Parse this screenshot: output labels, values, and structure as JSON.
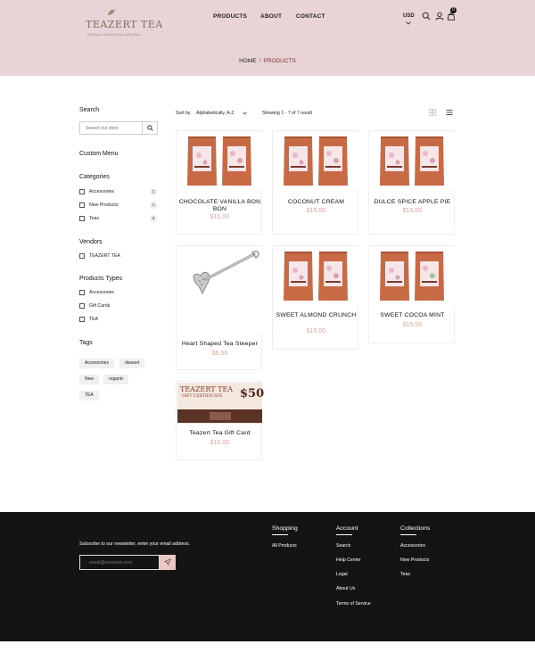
{
  "brand": {
    "name": "TEAZERT TEA",
    "tagline": "Delicious Gourmet Specialty Teas"
  },
  "nav": {
    "items": [
      "PRODUCTS",
      "ABOUT",
      "CONTACT"
    ],
    "currency": "USD",
    "cart_count": "0"
  },
  "breadcrumb": {
    "home": "HOME",
    "separator": "/",
    "current": "PRODUCTS"
  },
  "sidebar": {
    "search_heading": "Search",
    "search_placeholder": "Search our store",
    "custom_menu_heading": "Custom Menu",
    "categories_heading": "Categories",
    "categories": [
      {
        "label": "Accessories",
        "count": "1"
      },
      {
        "label": "New Products",
        "count": "1"
      },
      {
        "label": "Teas",
        "count": "3"
      }
    ],
    "vendors_heading": "Vendors",
    "vendors": [
      "TEAZERT TEA"
    ],
    "types_heading": "Products Types",
    "types": [
      "Accessories",
      "Gift Cards",
      "TEA"
    ],
    "tags_heading": "Tags",
    "tags": [
      "Accessories",
      "dessert",
      "New",
      "organic",
      "TEA"
    ]
  },
  "toolbar": {
    "sort_label": "Sort by",
    "sort_value": "Alphabetically, A-Z",
    "showing": "Showing 1 - 7 of 7 result"
  },
  "products": [
    {
      "name": "CHOCOLATE VANILLA BON BON",
      "price": "$15.00",
      "image": "tea-pouches"
    },
    {
      "name": "COCONUT CREAM",
      "price": "$15.00",
      "image": "tea-pouches"
    },
    {
      "name": "DULCE SPICE APPLE PIE",
      "price": "$15.00",
      "image": "tea-pouches"
    },
    {
      "name": "Heart Shaped Tea Steeper",
      "price": "$5.50",
      "image": "tea-steeper"
    },
    {
      "name": "SWEET ALMOND CRUNCH",
      "price": "$15.00",
      "image": "tea-pouches"
    },
    {
      "name": "SWEET COCOA MINT",
      "price": "$15.00",
      "image": "tea-pouches"
    },
    {
      "name": "Teazert Tea Gift Card",
      "price": "$10.00",
      "image": "gift-card"
    }
  ],
  "gift_card": {
    "brand": "TEAZERT TEA",
    "label": "GIFT CERTIFICATE",
    "amount": "$50"
  },
  "footer": {
    "newsletter_text": "Subscribe to our newsletter, enter your email address.",
    "email_placeholder": "email@example.com",
    "columns": [
      {
        "heading": "Shopping",
        "links": [
          "All Products"
        ]
      },
      {
        "heading": "Account",
        "links": [
          "Search",
          "Help Center",
          "Legal",
          "About Us",
          "Terms of Service"
        ]
      },
      {
        "heading": "Collections",
        "links": [
          "Accessories",
          "New Products",
          "Teas"
        ]
      }
    ]
  },
  "colors": {
    "header_bg": "#e8d3d6",
    "price": "#d4a99f",
    "pouch": "#c86a45",
    "footer_bg": "#141414",
    "accent": "#7b3c2e"
  }
}
